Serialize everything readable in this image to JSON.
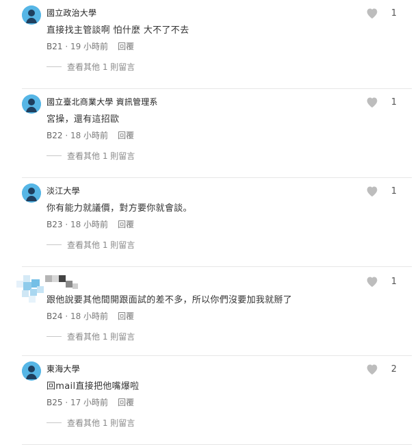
{
  "comments": [
    {
      "school": "國立政治大學",
      "content": "直接找主管談啊 怕什麼 大不了不去",
      "floor": "B21",
      "time": "19 小時前",
      "reply": "回覆",
      "more": "查看其他 1 則留言",
      "likes": "1",
      "anonymous": false
    },
    {
      "school": "國立臺北商業大學 資訊管理系",
      "content": "宮操，還有這招歐",
      "floor": "B22",
      "time": "18 小時前",
      "reply": "回覆",
      "more": "查看其他 1 則留言",
      "likes": "1",
      "anonymous": false
    },
    {
      "school": "淡江大學",
      "content": "你有能力就議價，對方要你就會談。",
      "floor": "B23",
      "time": "18 小時前",
      "reply": "回覆",
      "more": "查看其他 1 則留言",
      "likes": "1",
      "anonymous": false
    },
    {
      "school": "",
      "content": "跟他說要其他間開跟面試的差不多，所以你們沒要加我就掰了",
      "floor": "B24",
      "time": "18 小時前",
      "reply": "回覆",
      "more": "查看其他 1 則留言",
      "likes": "1",
      "anonymous": true
    },
    {
      "school": "東海大學",
      "content": "回mail直接把他嘴爆啦",
      "floor": "B25",
      "time": "17 小時前",
      "reply": "回覆",
      "more": "查看其他 1 則留言",
      "likes": "2",
      "anonymous": false
    }
  ],
  "colors": {
    "avatar": "#56b6e6",
    "heart": "#bdbdbd"
  },
  "icons": {
    "avatar": "avatar-icon",
    "like": "heart-icon"
  }
}
